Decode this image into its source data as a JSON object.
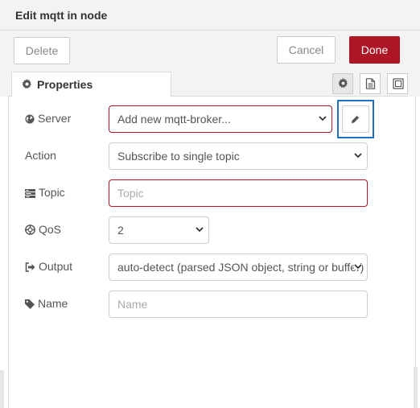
{
  "dialog": {
    "title": "Edit mqtt in node"
  },
  "buttons": {
    "delete": "Delete",
    "cancel": "Cancel",
    "done": "Done"
  },
  "tabs": {
    "properties": "Properties",
    "icons": [
      "gear-icon",
      "document-icon",
      "appearance-icon"
    ]
  },
  "form": {
    "server": {
      "label": "Server",
      "value": "Add new mqtt-broker..."
    },
    "action": {
      "label": "Action",
      "value": "Subscribe to single topic"
    },
    "topic": {
      "label": "Topic",
      "placeholder": "Topic"
    },
    "qos": {
      "label": "QoS",
      "value": "2"
    },
    "output": {
      "label": "Output",
      "value": "auto-detect (parsed JSON object, string or buffer)"
    },
    "name": {
      "label": "Name",
      "placeholder": "Name"
    }
  },
  "colors": {
    "accent": "#ad1625",
    "error_border": "#b31625",
    "focus_highlight": "#1f6fc5"
  }
}
